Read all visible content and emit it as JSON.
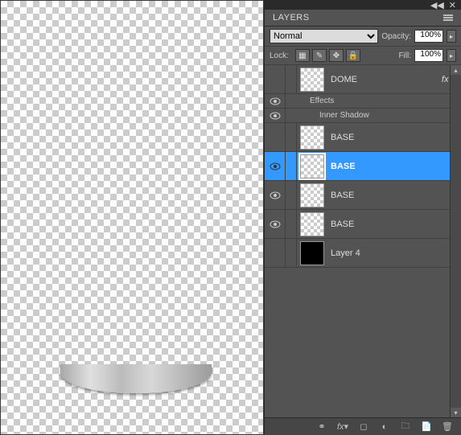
{
  "panel": {
    "title": "LAYERS"
  },
  "blend": {
    "mode": "Normal",
    "opacity_label": "Opacity:",
    "opacity_value": "100%"
  },
  "lock": {
    "label": "Lock:",
    "fill_label": "Fill:",
    "fill_value": "100%"
  },
  "layers": [
    {
      "name": "DOME",
      "visible": false,
      "selected": false,
      "thumb": "checker",
      "fx": true
    },
    {
      "name": "BASE",
      "visible": false,
      "selected": false,
      "thumb": "checker"
    },
    {
      "name": "BASE",
      "visible": true,
      "selected": true,
      "thumb": "checker"
    },
    {
      "name": "BASE",
      "visible": true,
      "selected": false,
      "thumb": "checker"
    },
    {
      "name": "BASE",
      "visible": true,
      "selected": false,
      "thumb": "checker"
    },
    {
      "name": "Layer 4",
      "visible": false,
      "selected": false,
      "thumb": "black"
    }
  ],
  "effects": {
    "header": "Effects",
    "items": [
      "Inner Shadow"
    ]
  },
  "fx_label": "fx"
}
